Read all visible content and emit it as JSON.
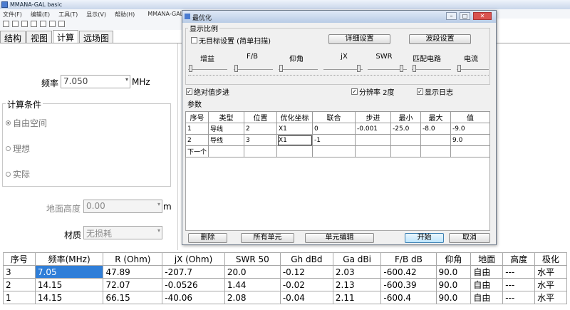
{
  "app": {
    "title": "MMANA-GAL basic",
    "title2": "MMANA-GALpro"
  },
  "menu": [
    "文件(F)",
    "编辑(E)",
    "工具(T)",
    "显示(V)",
    "帮助(H)"
  ],
  "tabs": [
    "结构",
    "视图",
    "计算",
    "远场图"
  ],
  "calc": {
    "freq_label": "频率",
    "freq_value": "7.050",
    "freq_unit": "MHz",
    "cond_title": "计算条件",
    "radios": [
      "自由空间",
      "理想",
      "实际"
    ],
    "ground_label": "地面高度",
    "ground_value": "0.00",
    "ground_unit": "m",
    "material_label": "材质",
    "material_value": "无损耗"
  },
  "results": {
    "headers": [
      "序号",
      "频率(MHz)",
      "R (Ohm)",
      "jX (Ohm)",
      "SWR 50",
      "Gh dBd",
      "Ga dBi",
      "F/B dB",
      "仰角",
      "地面",
      "高度",
      "极化"
    ],
    "rows": [
      [
        "3",
        "7.05",
        "47.89",
        "-207.7",
        "20.0",
        "-0.12",
        "2.03",
        "-600.42",
        "90.0",
        "自由",
        "---",
        "水平"
      ],
      [
        "2",
        "14.15",
        "72.07",
        "-0.0526",
        "1.44",
        "-0.02",
        "2.13",
        "-600.39",
        "90.0",
        "自由",
        "---",
        "水平"
      ],
      [
        "1",
        "14.15",
        "66.15",
        "-40.06",
        "2.08",
        "-0.04",
        "2.11",
        "-600.4",
        "90.0",
        "自由",
        "---",
        "水平"
      ]
    ]
  },
  "dialog": {
    "title": "最优化",
    "scale_title": "显示比例",
    "no_target": "无目标设置 (简单扫描)",
    "btn_detail": "详细设置",
    "btn_band": "波段设置",
    "sliders": [
      "增益",
      "F/B",
      "仰角",
      "jX",
      "SWR",
      "匹配电路",
      "电流"
    ],
    "abs_step": "绝对值步进",
    "resolution": "分辨率 2度",
    "show_log": "显示日志",
    "params_label": "参数",
    "param_headers": [
      "序号",
      "类型",
      "位置",
      "优化坐标",
      "联合",
      "步进",
      "最小",
      "最大",
      "值"
    ],
    "param_rows": [
      [
        "1",
        "导线",
        "2",
        "X1",
        "0",
        "-0.001",
        "-25.0",
        "-8.0",
        "-9.0"
      ],
      [
        "2",
        "导线",
        "3",
        "X1",
        "-1",
        "",
        "",
        "",
        "9.0"
      ]
    ],
    "next_label": "下一个",
    "btn_delete": "删除",
    "btn_all": "所有单元",
    "btn_edit": "单元编辑",
    "btn_start": "开始",
    "btn_cancel": "取消"
  }
}
